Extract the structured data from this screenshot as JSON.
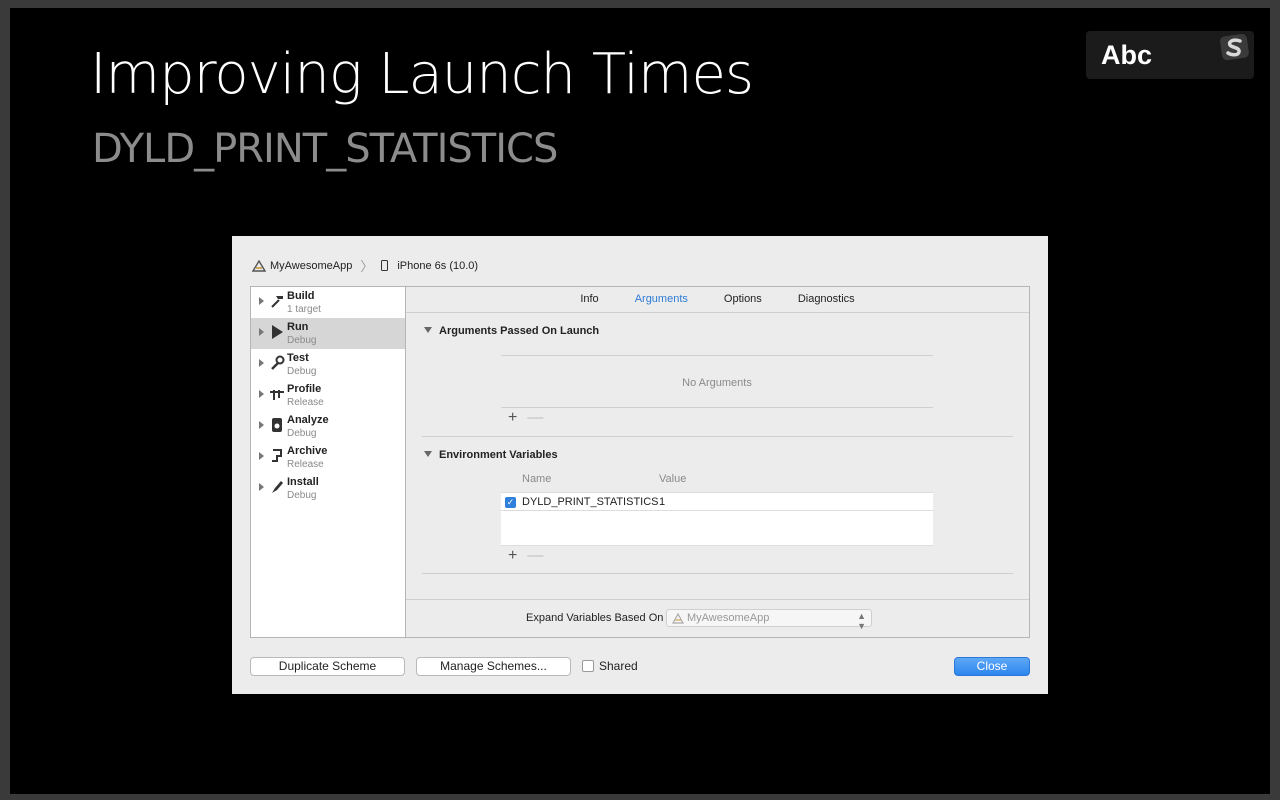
{
  "slide": {
    "title": "Improving Launch Times",
    "subtitle": "DYLD_PRINT_STATISTICS",
    "badge": "Abc"
  },
  "window": {
    "breadcrumb": {
      "app": "MyAwesomeApp",
      "device": "iPhone 6s (10.0)"
    },
    "sidebar": {
      "items": [
        {
          "name": "Build",
          "sub": "1 target",
          "icon": "hammer-icon"
        },
        {
          "name": "Run",
          "sub": "Debug",
          "icon": "play-icon"
        },
        {
          "name": "Test",
          "sub": "Debug",
          "icon": "wrench-icon"
        },
        {
          "name": "Profile",
          "sub": "Release",
          "icon": "instruments-icon"
        },
        {
          "name": "Analyze",
          "sub": "Debug",
          "icon": "analyze-icon"
        },
        {
          "name": "Archive",
          "sub": "Release",
          "icon": "archive-icon"
        },
        {
          "name": "Install",
          "sub": "Debug",
          "icon": "install-icon"
        }
      ],
      "selected": "Run"
    },
    "tabs": [
      {
        "label": "Info"
      },
      {
        "label": "Arguments"
      },
      {
        "label": "Options"
      },
      {
        "label": "Diagnostics"
      }
    ],
    "active_tab": "Arguments",
    "arguments": {
      "header": "Arguments Passed On Launch",
      "empty_text": "No Arguments"
    },
    "env": {
      "header": "Environment Variables",
      "col_name": "Name",
      "col_value": "Value",
      "rows": [
        {
          "name": "DYLD_PRINT_STATISTICS",
          "value": "1",
          "checked": true
        }
      ]
    },
    "plus": "+",
    "minus": "—",
    "expand": {
      "label": "Expand Variables Based On",
      "value": "MyAwesomeApp"
    },
    "buttons": {
      "duplicate": "Duplicate Scheme",
      "manage": "Manage Schemes...",
      "shared": "Shared",
      "close": "Close"
    },
    "colors": {
      "accent": "#2e7cd6",
      "close_button": "#2d86ee"
    }
  }
}
